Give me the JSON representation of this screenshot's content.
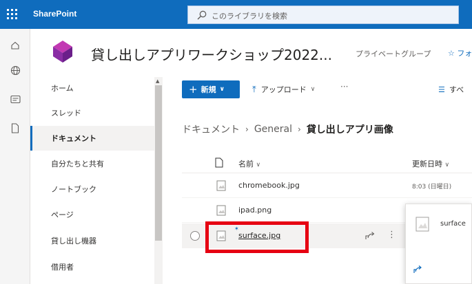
{
  "suite": {
    "app_name": "SharePoint",
    "search_placeholder": "このライブラリを検索"
  },
  "site": {
    "title": "貸し出しアプリワークショップ2022...",
    "group_type": "プライベートグループ",
    "follow_label": "☆ フォ"
  },
  "leftnav": {
    "items": [
      {
        "label": "ホーム"
      },
      {
        "label": "スレッド"
      },
      {
        "label": "ドキュメント"
      },
      {
        "label": "自分たちと共有"
      },
      {
        "label": "ノートブック"
      },
      {
        "label": "ページ"
      },
      {
        "label": "貸し出し機器"
      },
      {
        "label": "借用者"
      }
    ],
    "selected_index": 2
  },
  "commandbar": {
    "new_label": "新規",
    "upload_label": "アップロード",
    "more_label": "···",
    "view_label": "すべ"
  },
  "breadcrumb": {
    "items": [
      "ドキュメント",
      "General",
      "貸し出しアプリ画像"
    ]
  },
  "list": {
    "columns": {
      "name": "名前",
      "modified": "更新日時"
    },
    "rows": [
      {
        "name": "chromebook.jpg",
        "modified": "8:03 (日曜日)"
      },
      {
        "name": "ipad.png",
        "modified": ""
      },
      {
        "name": "surface.jpg",
        "modified": ""
      }
    ]
  },
  "hover_card": {
    "file_name": "surface"
  },
  "colors": {
    "suite_bar": "#0f6cbd",
    "accent": "#0f6cbd",
    "highlight": "#e60012"
  }
}
